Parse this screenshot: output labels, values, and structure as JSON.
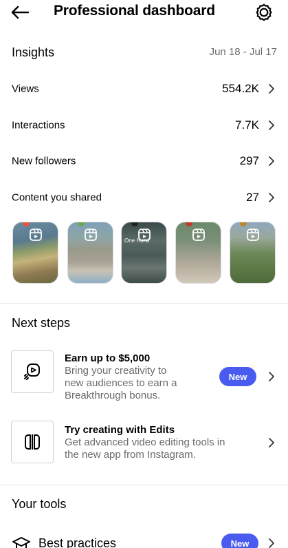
{
  "header": {
    "title": "Professional dashboard",
    "back_icon": "arrow-left-icon",
    "settings_icon": "settings-icon"
  },
  "insights": {
    "title": "Insights",
    "date_range": "Jun 18 - Jul 17",
    "metrics": [
      {
        "label": "Views",
        "value": "554.2K"
      },
      {
        "label": "Interactions",
        "value": "7.7K"
      },
      {
        "label": "New followers",
        "value": "297"
      },
      {
        "label": "Content you shared",
        "value": "27"
      }
    ],
    "thumbnails": [
      {
        "type": "reel",
        "icon": "reel-icon",
        "caption": ""
      },
      {
        "type": "reel",
        "icon": "reel-icon",
        "caption": ""
      },
      {
        "type": "reel",
        "icon": "reel-icon",
        "caption": "One Hund"
      },
      {
        "type": "reel",
        "icon": "reel-icon",
        "caption": ""
      },
      {
        "type": "reel",
        "icon": "reel-icon",
        "caption": ""
      }
    ]
  },
  "next_steps": {
    "title": "Next steps",
    "items": [
      {
        "title": "Earn up to $5,000",
        "desc_lines": [
          "Bring your creativity to",
          "new audiences to earn a",
          "Breakthrough bonus."
        ],
        "badge": "New",
        "icon": "reel-bonus-icon"
      },
      {
        "title": "Try creating with Edits",
        "desc_lines": [
          "Get advanced video editing tools in",
          "the new app from Instagram."
        ],
        "badge": "",
        "icon": "edits-app-icon"
      }
    ]
  },
  "tools": {
    "title": "Your tools",
    "items": [
      {
        "label": "Best practices",
        "badge": "New",
        "icon": "graduation-cap-icon"
      }
    ]
  },
  "colors": {
    "accent": "#4a5cf0",
    "muted_text": "#6b6b6b",
    "divider": "#e6e6e6"
  }
}
